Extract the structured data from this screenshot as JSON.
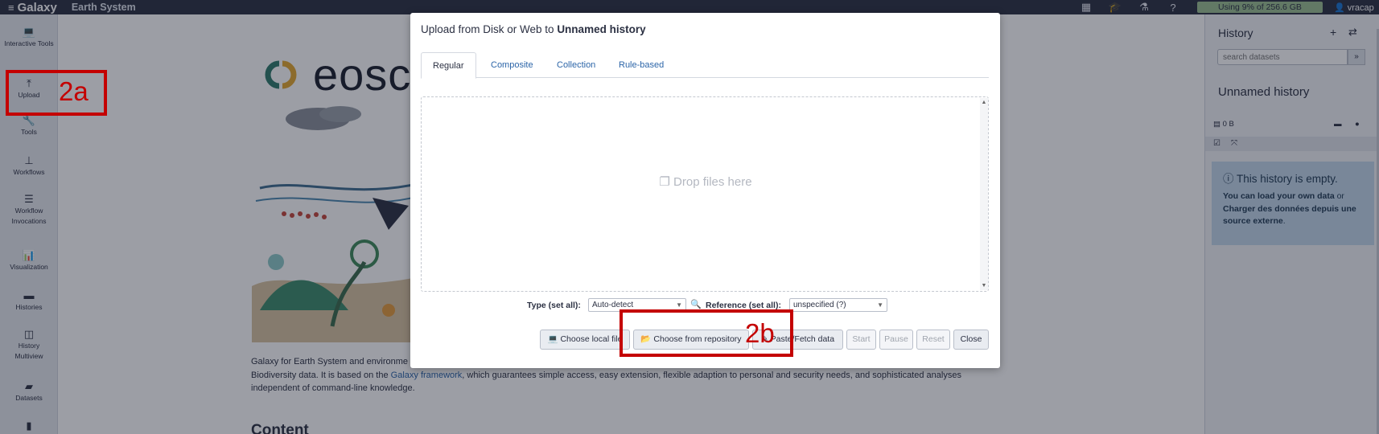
{
  "masthead": {
    "brand": "Galaxy",
    "subtitle": "Earth System",
    "quota": "Using 9% of 256.6 GB",
    "user": "vracap"
  },
  "activity": [
    {
      "label": "Interactive Tools",
      "icon": "laptop-icon"
    },
    {
      "label": "Upload",
      "icon": "upload-icon"
    },
    {
      "label": "Tools",
      "icon": "wrench-icon"
    },
    {
      "label": "Workflows",
      "icon": "sitemap-icon"
    },
    {
      "label": "Workflow Invocations",
      "icon": "list-icon"
    },
    {
      "label": "Visualization",
      "icon": "chart-icon"
    },
    {
      "label": "Histories",
      "icon": "hdd-icon"
    },
    {
      "label": "History Multiview",
      "icon": "columns-icon"
    },
    {
      "label": "Datasets",
      "icon": "folder-icon"
    }
  ],
  "main": {
    "logo_text": "eosc",
    "intro_prefix": "Galaxy for Earth System and environme",
    "intro_line2_prefix": "Biodiversity data. It is based on the ",
    "intro_link": "Galaxy framework",
    "intro_line2_suffix": ", which guarantees simple access, easy extension, flexible adaption to personal and security needs, and sophisticated analyses",
    "intro_line3": "independent of command-line knowledge.",
    "content_heading": "Content"
  },
  "history": {
    "title": "History",
    "search_placeholder": "search datasets",
    "name": "Unnamed history",
    "size": "0 B",
    "empty_title": "This history is empty.",
    "empty_link1": "You can load your own data",
    "empty_or": " or ",
    "empty_link2": "Charger des données depuis une source externe",
    "empty_end": "."
  },
  "modal": {
    "title_prefix": "Upload from Disk or Web to ",
    "title_history": "Unnamed history",
    "tabs": [
      "Regular",
      "Composite",
      "Collection",
      "Rule-based"
    ],
    "drop_text": "Drop files here",
    "type_label": "Type (set all):",
    "type_value": "Auto-detect",
    "reference_label": "Reference (set all):",
    "reference_value": "unspecified (?)",
    "buttons": {
      "choose_local": "Choose local file",
      "choose_repo": "Choose from repository",
      "paste": "Paste/Fetch data",
      "start": "Start",
      "pause": "Pause",
      "reset": "Reset",
      "close": "Close"
    }
  },
  "annotations": {
    "label_a": "2a",
    "label_b": "2b",
    "color": "#c40000"
  }
}
